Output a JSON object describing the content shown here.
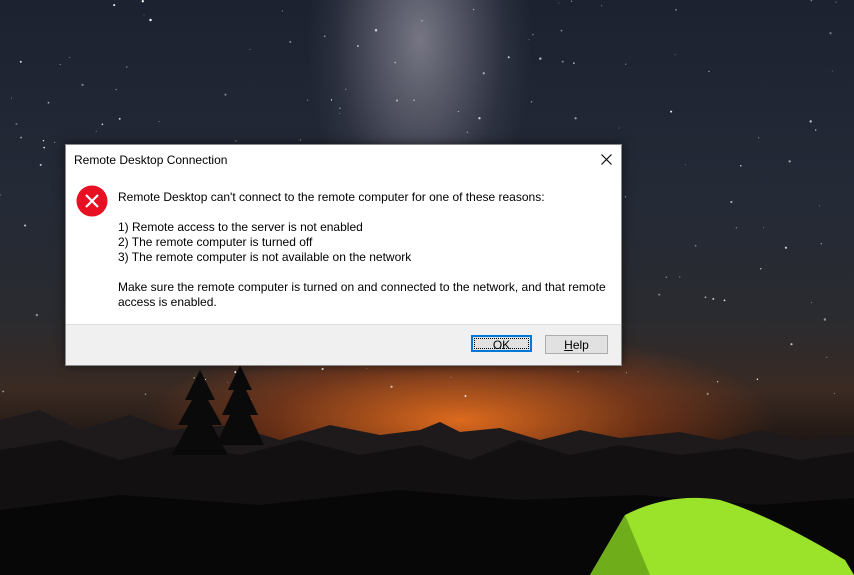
{
  "dialog": {
    "title": "Remote Desktop Connection",
    "close_icon": "close-icon",
    "status_icon": "error-icon",
    "message": "Remote Desktop can't connect to the remote computer for one of these reasons:",
    "reasons": [
      "1) Remote access to the server is not enabled",
      "2) The remote computer is turned off",
      "3) The remote computer is not available on the network"
    ],
    "advice": "Make sure the remote computer is turned on and connected to the network, and that remote access is enabled.",
    "buttons": {
      "ok_label": "OK",
      "help_label_prefix": "",
      "help_label_mnemonic": "H",
      "help_label_rest": "elp"
    }
  },
  "colors": {
    "error_red": "#e81123",
    "accent_blue": "#0078d7",
    "tent_green": "#9be22b"
  }
}
